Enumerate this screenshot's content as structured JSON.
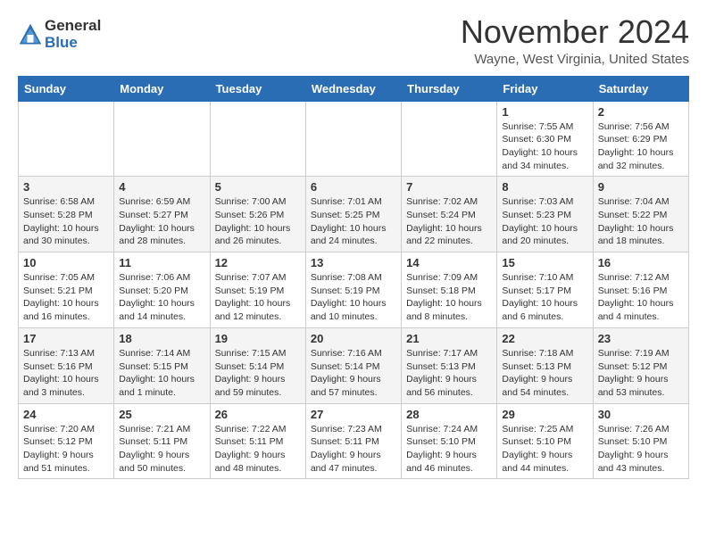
{
  "header": {
    "logo_general": "General",
    "logo_blue": "Blue",
    "month_title": "November 2024",
    "location": "Wayne, West Virginia, United States"
  },
  "days_of_week": [
    "Sunday",
    "Monday",
    "Tuesday",
    "Wednesday",
    "Thursday",
    "Friday",
    "Saturday"
  ],
  "weeks": [
    [
      {
        "day": "",
        "info": ""
      },
      {
        "day": "",
        "info": ""
      },
      {
        "day": "",
        "info": ""
      },
      {
        "day": "",
        "info": ""
      },
      {
        "day": "",
        "info": ""
      },
      {
        "day": "1",
        "info": "Sunrise: 7:55 AM\nSunset: 6:30 PM\nDaylight: 10 hours and 34 minutes."
      },
      {
        "day": "2",
        "info": "Sunrise: 7:56 AM\nSunset: 6:29 PM\nDaylight: 10 hours and 32 minutes."
      }
    ],
    [
      {
        "day": "3",
        "info": "Sunrise: 6:58 AM\nSunset: 5:28 PM\nDaylight: 10 hours and 30 minutes."
      },
      {
        "day": "4",
        "info": "Sunrise: 6:59 AM\nSunset: 5:27 PM\nDaylight: 10 hours and 28 minutes."
      },
      {
        "day": "5",
        "info": "Sunrise: 7:00 AM\nSunset: 5:26 PM\nDaylight: 10 hours and 26 minutes."
      },
      {
        "day": "6",
        "info": "Sunrise: 7:01 AM\nSunset: 5:25 PM\nDaylight: 10 hours and 24 minutes."
      },
      {
        "day": "7",
        "info": "Sunrise: 7:02 AM\nSunset: 5:24 PM\nDaylight: 10 hours and 22 minutes."
      },
      {
        "day": "8",
        "info": "Sunrise: 7:03 AM\nSunset: 5:23 PM\nDaylight: 10 hours and 20 minutes."
      },
      {
        "day": "9",
        "info": "Sunrise: 7:04 AM\nSunset: 5:22 PM\nDaylight: 10 hours and 18 minutes."
      }
    ],
    [
      {
        "day": "10",
        "info": "Sunrise: 7:05 AM\nSunset: 5:21 PM\nDaylight: 10 hours and 16 minutes."
      },
      {
        "day": "11",
        "info": "Sunrise: 7:06 AM\nSunset: 5:20 PM\nDaylight: 10 hours and 14 minutes."
      },
      {
        "day": "12",
        "info": "Sunrise: 7:07 AM\nSunset: 5:19 PM\nDaylight: 10 hours and 12 minutes."
      },
      {
        "day": "13",
        "info": "Sunrise: 7:08 AM\nSunset: 5:19 PM\nDaylight: 10 hours and 10 minutes."
      },
      {
        "day": "14",
        "info": "Sunrise: 7:09 AM\nSunset: 5:18 PM\nDaylight: 10 hours and 8 minutes."
      },
      {
        "day": "15",
        "info": "Sunrise: 7:10 AM\nSunset: 5:17 PM\nDaylight: 10 hours and 6 minutes."
      },
      {
        "day": "16",
        "info": "Sunrise: 7:12 AM\nSunset: 5:16 PM\nDaylight: 10 hours and 4 minutes."
      }
    ],
    [
      {
        "day": "17",
        "info": "Sunrise: 7:13 AM\nSunset: 5:16 PM\nDaylight: 10 hours and 3 minutes."
      },
      {
        "day": "18",
        "info": "Sunrise: 7:14 AM\nSunset: 5:15 PM\nDaylight: 10 hours and 1 minute."
      },
      {
        "day": "19",
        "info": "Sunrise: 7:15 AM\nSunset: 5:14 PM\nDaylight: 9 hours and 59 minutes."
      },
      {
        "day": "20",
        "info": "Sunrise: 7:16 AM\nSunset: 5:14 PM\nDaylight: 9 hours and 57 minutes."
      },
      {
        "day": "21",
        "info": "Sunrise: 7:17 AM\nSunset: 5:13 PM\nDaylight: 9 hours and 56 minutes."
      },
      {
        "day": "22",
        "info": "Sunrise: 7:18 AM\nSunset: 5:13 PM\nDaylight: 9 hours and 54 minutes."
      },
      {
        "day": "23",
        "info": "Sunrise: 7:19 AM\nSunset: 5:12 PM\nDaylight: 9 hours and 53 minutes."
      }
    ],
    [
      {
        "day": "24",
        "info": "Sunrise: 7:20 AM\nSunset: 5:12 PM\nDaylight: 9 hours and 51 minutes."
      },
      {
        "day": "25",
        "info": "Sunrise: 7:21 AM\nSunset: 5:11 PM\nDaylight: 9 hours and 50 minutes."
      },
      {
        "day": "26",
        "info": "Sunrise: 7:22 AM\nSunset: 5:11 PM\nDaylight: 9 hours and 48 minutes."
      },
      {
        "day": "27",
        "info": "Sunrise: 7:23 AM\nSunset: 5:11 PM\nDaylight: 9 hours and 47 minutes."
      },
      {
        "day": "28",
        "info": "Sunrise: 7:24 AM\nSunset: 5:10 PM\nDaylight: 9 hours and 46 minutes."
      },
      {
        "day": "29",
        "info": "Sunrise: 7:25 AM\nSunset: 5:10 PM\nDaylight: 9 hours and 44 minutes."
      },
      {
        "day": "30",
        "info": "Sunrise: 7:26 AM\nSunset: 5:10 PM\nDaylight: 9 hours and 43 minutes."
      }
    ]
  ]
}
